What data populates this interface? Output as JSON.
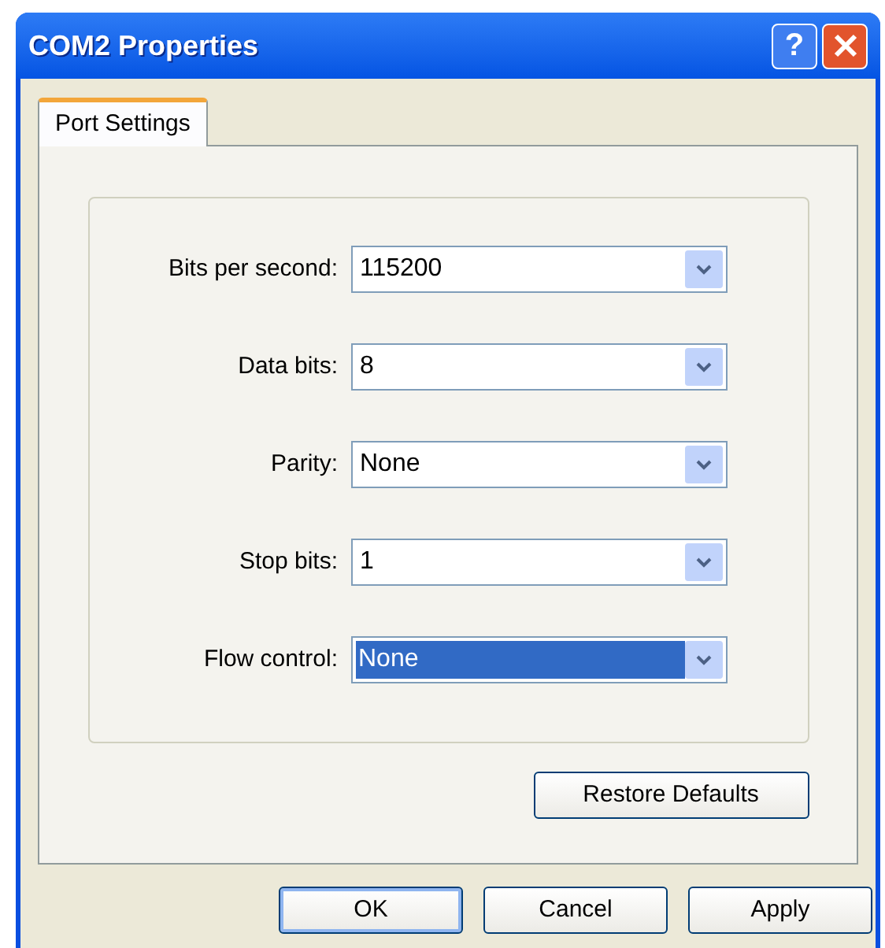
{
  "window": {
    "title": "COM2 Properties",
    "help_label": "?"
  },
  "tabs": [
    {
      "label": "Port Settings",
      "selected": true
    }
  ],
  "fields": [
    {
      "label": "Bits per second:",
      "value": "115200",
      "focused": false
    },
    {
      "label": "Data bits:",
      "value": "8",
      "focused": false
    },
    {
      "label": "Parity:",
      "value": "None",
      "focused": false
    },
    {
      "label": "Stop bits:",
      "value": "1",
      "focused": false
    },
    {
      "label": "Flow control:",
      "value": "None",
      "focused": true
    }
  ],
  "restore_button": "Restore Defaults",
  "buttons": [
    {
      "label": "OK",
      "default": true
    },
    {
      "label": "Cancel",
      "default": false
    },
    {
      "label": "Apply",
      "default": false
    }
  ]
}
